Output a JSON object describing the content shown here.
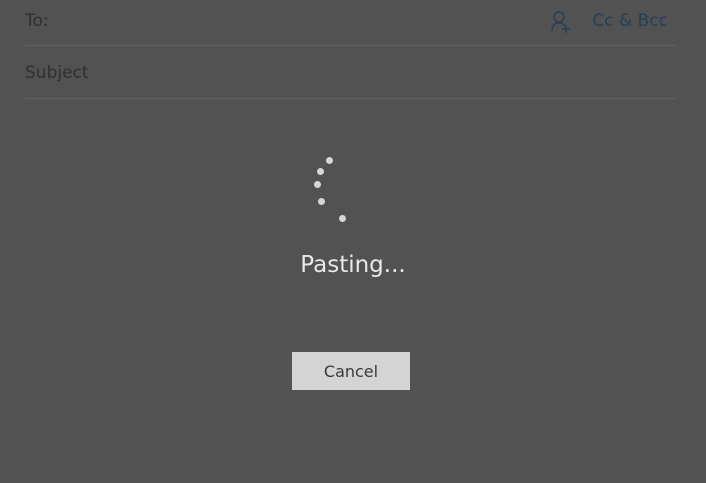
{
  "compose": {
    "to_label": "To:",
    "subject_placeholder": "Subject",
    "cc_bcc_label": "Cc & Bcc",
    "add_contact_icon": "add-person-icon"
  },
  "dialog": {
    "status_text": "Pasting...",
    "cancel_label": "Cancel",
    "spinner_icon": "loading-spinner"
  },
  "colors": {
    "overlay": "#525252",
    "link": "#273f57",
    "button": "#d4d4d4",
    "status_text": "#e8e8e8"
  }
}
